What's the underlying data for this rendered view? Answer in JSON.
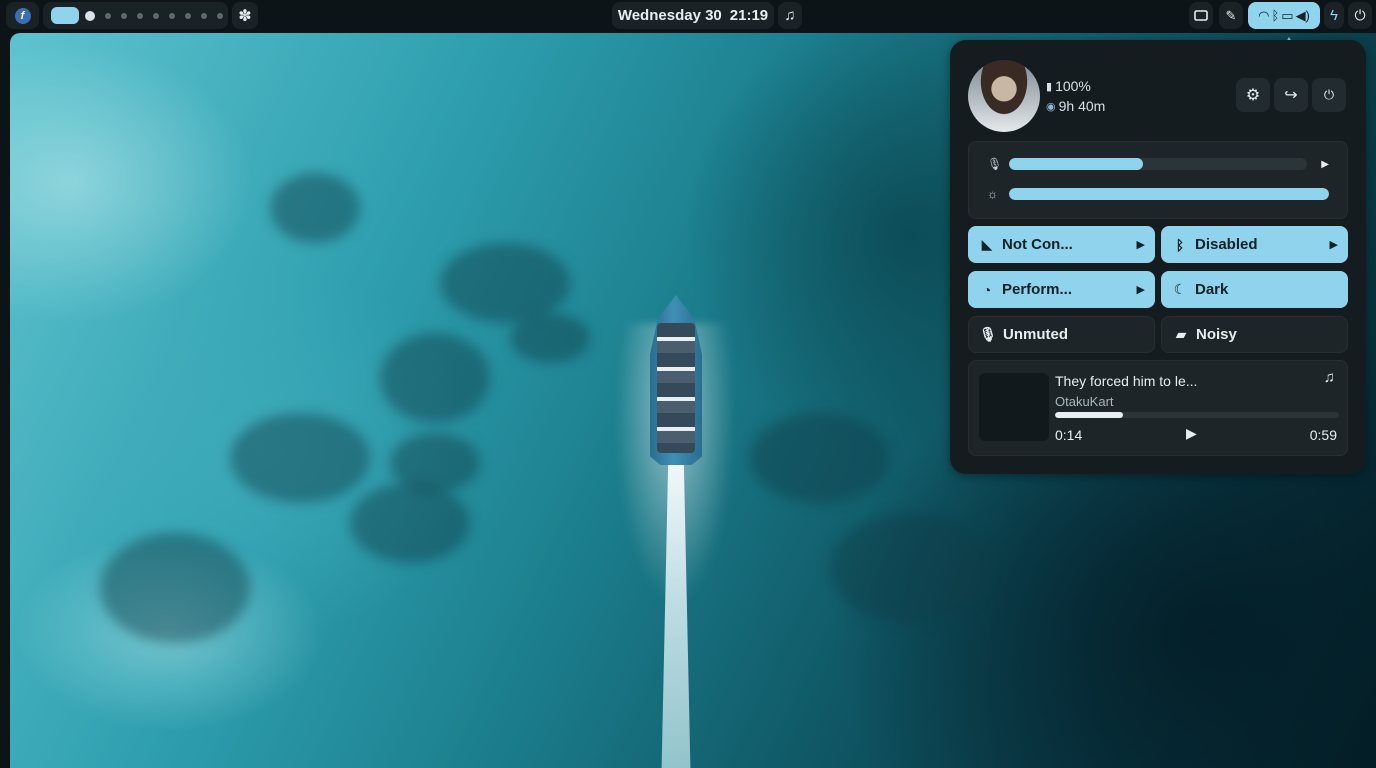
{
  "topbar": {
    "clock_day": "Wednesday 30",
    "clock_time": "21:19",
    "workspace_count": 9,
    "active_workspace": 1
  },
  "panel": {
    "battery": "100%",
    "time_remaining": "9h 40m",
    "mic_level": 0.45,
    "brightness_level": 1.0,
    "tiles": {
      "wifi": "Not Con...",
      "bluetooth": "Disabled",
      "power_profile": "Perform...",
      "theme": "Dark",
      "mic": "Unmuted",
      "notifications": "Noisy"
    },
    "media": {
      "title": "They forced him to le...",
      "artist": "OtakuKart",
      "position": "0:14",
      "duration": "0:59",
      "progress": 0.24
    }
  },
  "colors": {
    "accent": "#8fd4ec",
    "panel_bg": "#151c1f",
    "tile_bg": "#1d2528"
  }
}
